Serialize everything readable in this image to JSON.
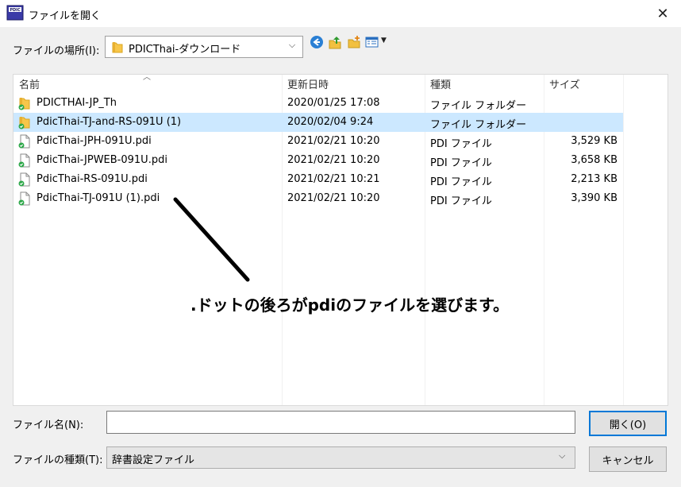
{
  "window": {
    "title": "ファイルを開く",
    "app_icon_text": "PDIC",
    "close_glyph": "✕"
  },
  "location": {
    "label": "ファイルの場所(I):",
    "value": "PDICThai-ダウンロード"
  },
  "columns": {
    "name": "名前",
    "date": "更新日時",
    "type": "種類",
    "size": "サイズ"
  },
  "files": [
    {
      "name": "PDICTHAI-JP_Th",
      "date": "2020/01/25 17:08",
      "type": "ファイル フォルダー",
      "size": "",
      "icon": "folder-icon",
      "selected": false
    },
    {
      "name": "PdicThai-TJ-and-RS-091U (1)",
      "date": "2020/02/04 9:24",
      "type": "ファイル フォルダー",
      "size": "",
      "icon": "folder-icon",
      "selected": true
    },
    {
      "name": "PdicThai-JPH-091U.pdi",
      "date": "2021/02/21 10:20",
      "type": "PDI ファイル",
      "size": "3,529 KB",
      "icon": "file-icon",
      "selected": false
    },
    {
      "name": "PdicThai-JPWEB-091U.pdi",
      "date": "2021/02/21 10:20",
      "type": "PDI ファイル",
      "size": "3,658 KB",
      "icon": "file-icon",
      "selected": false
    },
    {
      "name": "PdicThai-RS-091U.pdi",
      "date": "2021/02/21 10:21",
      "type": "PDI ファイル",
      "size": "2,213 KB",
      "icon": "file-icon",
      "selected": false
    },
    {
      "name": "PdicThai-TJ-091U (1).pdi",
      "date": "2021/02/21 10:20",
      "type": "PDI ファイル",
      "size": "3,390 KB",
      "icon": "file-icon",
      "selected": false
    }
  ],
  "annotation": ".ドットの後ろがpdiのファイルを選びます。",
  "filename": {
    "label": "ファイル名(N):",
    "value": ""
  },
  "filetype": {
    "label": "ファイルの種類(T):",
    "value": "辞書設定ファイル"
  },
  "buttons": {
    "open": "開く(O)",
    "cancel": "キャンセル"
  }
}
